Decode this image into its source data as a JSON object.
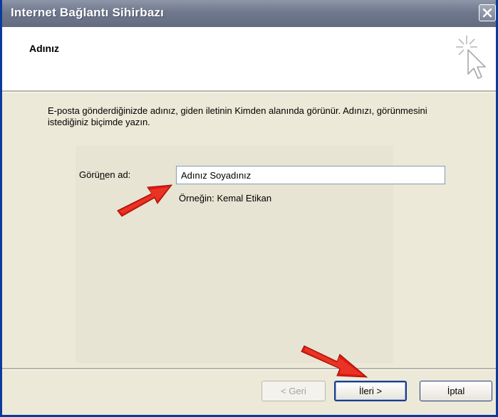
{
  "window": {
    "title": "Internet Bağlantı Sihirbazı"
  },
  "header": {
    "title": "Adınız"
  },
  "instruction": "E-posta gönderdiğinizde adınız, giden iletinin Kimden alanında görünür. Adınızı, görünmesini istediğiniz biçimde yazın.",
  "form": {
    "label_prefix": "Görü",
    "label_mnemonic": "n",
    "label_suffix": "en ad:",
    "input_value": "Adınız Soyadınız",
    "example": "Örneğin: Kemal Etikan"
  },
  "buttons": {
    "back": "< Geri",
    "next": "İleri >",
    "cancel": "İptal"
  },
  "colors": {
    "annotation_arrow": "#e01a12"
  }
}
